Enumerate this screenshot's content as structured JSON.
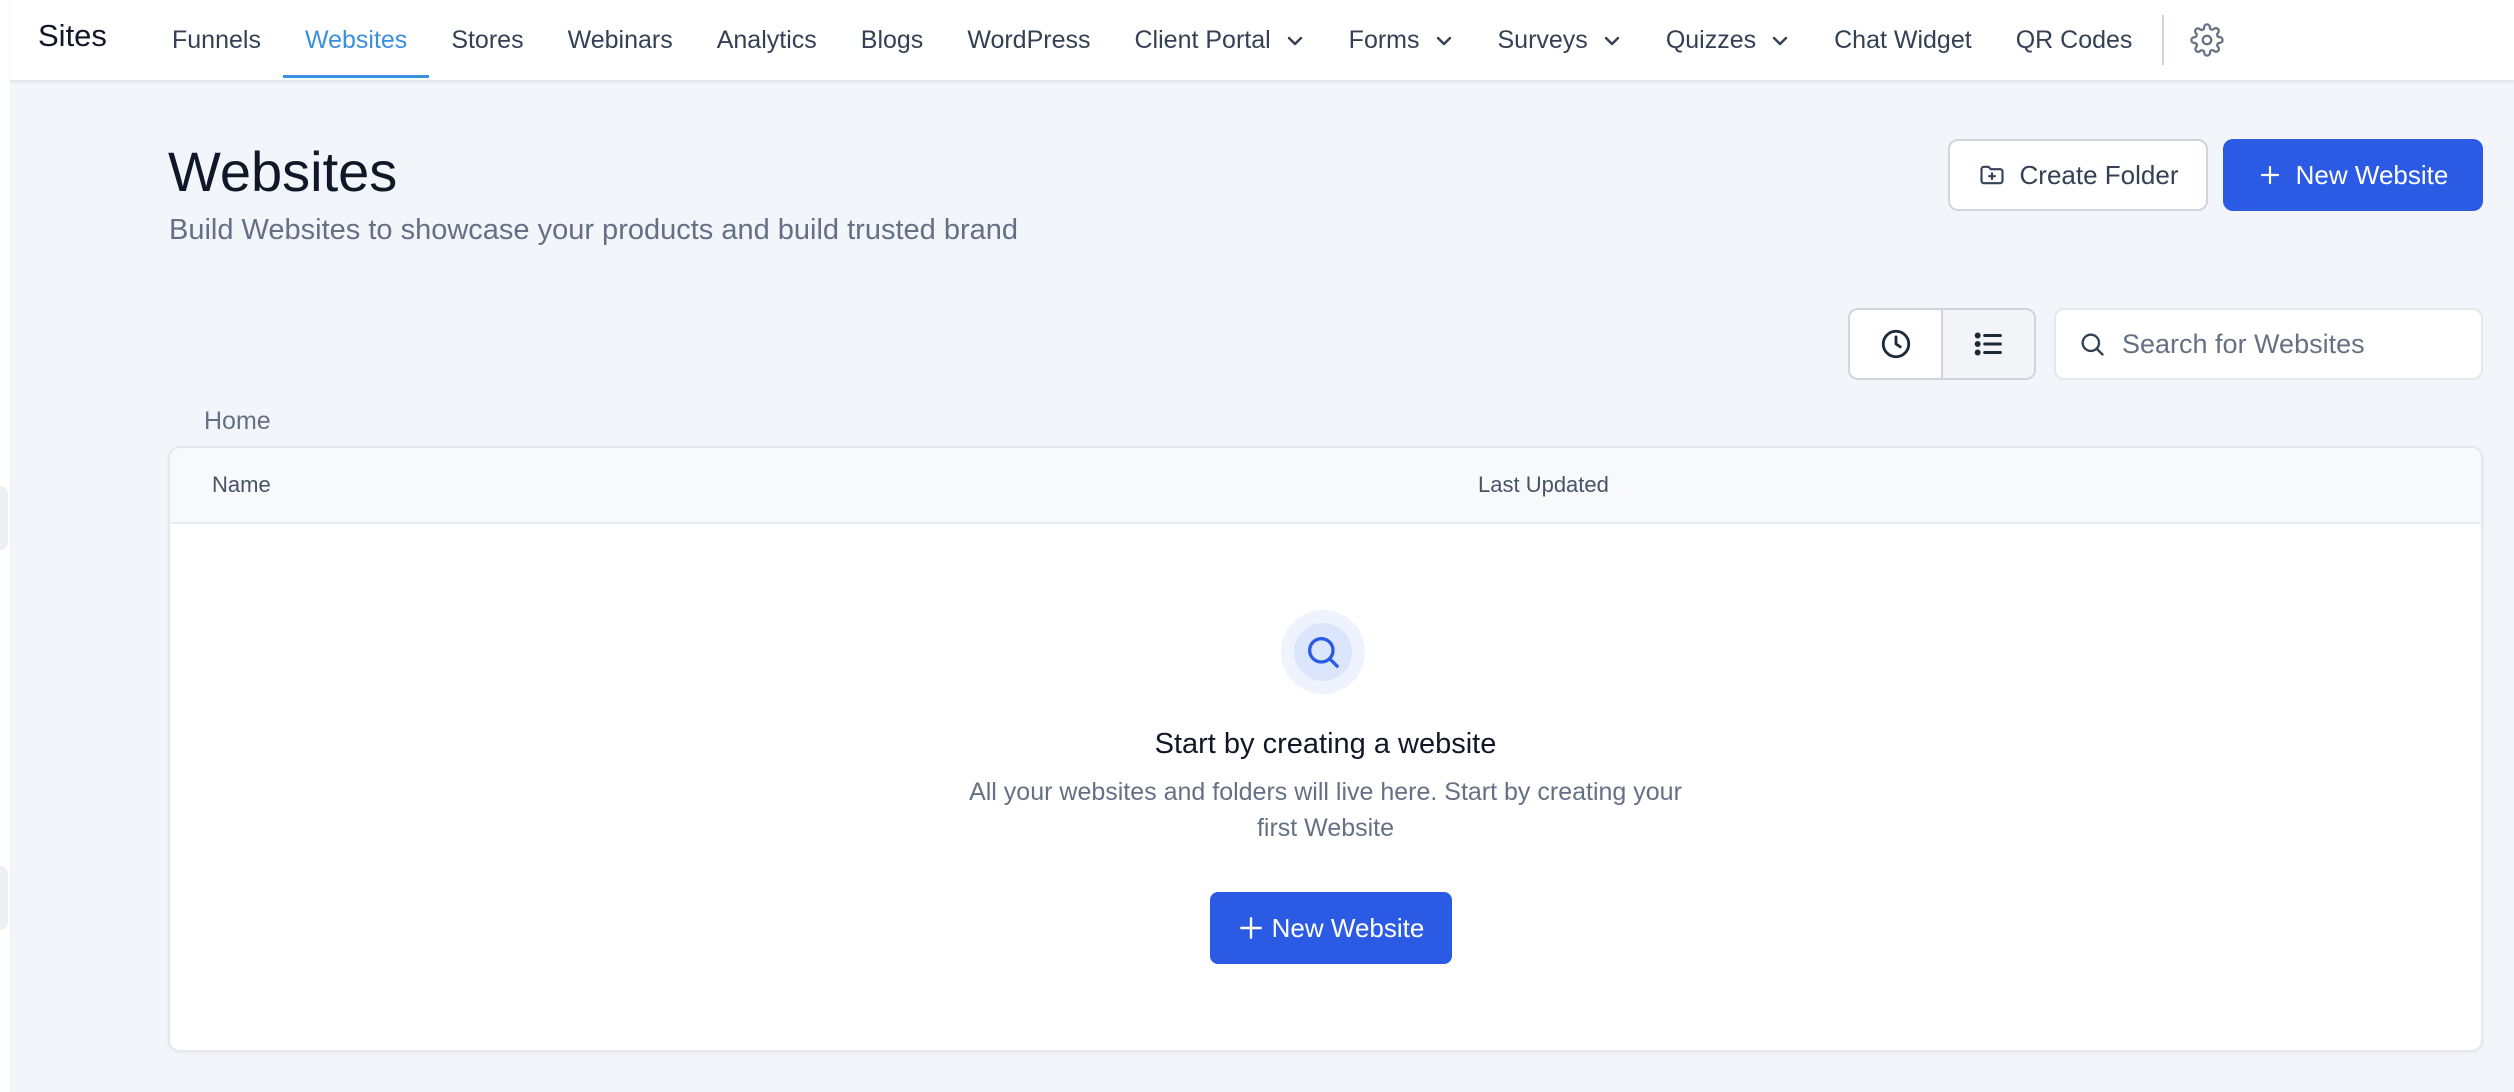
{
  "nav": {
    "brand": "Sites",
    "items": [
      {
        "label": "Funnels"
      },
      {
        "label": "Websites"
      },
      {
        "label": "Stores"
      },
      {
        "label": "Webinars"
      },
      {
        "label": "Analytics"
      },
      {
        "label": "Blogs"
      },
      {
        "label": "WordPress"
      },
      {
        "label": "Client Portal"
      },
      {
        "label": "Forms"
      },
      {
        "label": "Surveys"
      },
      {
        "label": "Quizzes"
      },
      {
        "label": "Chat Widget"
      },
      {
        "label": "QR Codes"
      }
    ],
    "active_item": "Websites",
    "settings_icon": "gear-icon"
  },
  "header": {
    "title": "Websites",
    "subtitle": "Build Websites to showcase your products and build trusted brand",
    "create_folder_label": "Create Folder",
    "new_website_label": "New Website"
  },
  "toolbar": {
    "search_placeholder": "Search for Websites",
    "recent_icon": "clock-icon",
    "list_icon": "list-icon"
  },
  "breadcrumb": {
    "home": "Home"
  },
  "table": {
    "columns": [
      "Name",
      "Last Updated"
    ],
    "rows": []
  },
  "empty_state": {
    "icon": "search-icon",
    "title": "Start by creating a website",
    "description": "All your websites and folders will live here. Start by creating your first Website",
    "button_label": "New Website"
  },
  "colors": {
    "primary": "#2b5be5",
    "active_tab": "#3a8fe0",
    "page_background": "#f2f5f9"
  }
}
